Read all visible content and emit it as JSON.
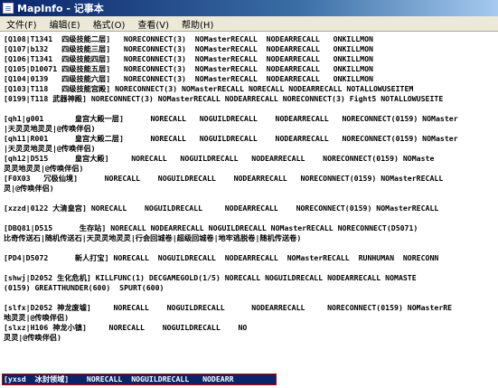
{
  "window": {
    "title": "MapInfo - 记事本"
  },
  "menu": [
    "文件(F)",
    "编辑(E)",
    "格式(O)",
    "查看(V)",
    "帮助(H)"
  ],
  "lines": [
    "[Q108|T1341  四级技能二层]   NORECONNECT(3)  NOMasterRECALL  NODEARRECALL   ONKILLMON",
    "[Q107|b132   四级技能三层]   NORECONNECT(3)  NOMasterRECALL  NODEARRECALL   ONKILLMON",
    "[Q106|T1341  四级技能四层]   NORECONNECT(3)  NOMasterRECALL  NODEARRECALL   ONKILLMON",
    "[Q105|D10071 四级技能五层]   NORECONNECT(3)  NOMasterRECALL  NODEARRECALL   ONKILLMON",
    "[Q104|0139   四级技能六层]   NORECONNECT(3)  NOMasterRECALL  NODEARRECALL   ONKILLMON",
    "[Q103|T118   四级技能宫殿] NORECONNECT(3) NOMasterRECALL NORECALL NODEARRECALL NOTALLOWUSEITEM",
    "[0199|T118 武器神殿] NORECONNECT(3) NOMasterRECALL NODEARRECALL NORECONNECT(3) Fight5 NOTALLOWUSEITE",
    "",
    "[qh1|g001       皇宫大殿一层]      NORECALL   NOGUILDRECALL    NODEARRECALL   NORECONNECT(0159) NOMaster",
    "|天灵灵地灵灵|@传唤伴侣)",
    "[qh11|R001      皇宫大殿二层]      NORECALL   NOGUILDRECALL    NODEARRECALL   NORECONNECT(0159) NOMaster",
    "|天灵灵地灵灵|@传唤伴侣)",
    "[qh12|D515      皇宫大殿]     NORECALL   NOGUILDRECALL   NODEARRECALL    NORECONNECT(0159) NOMaste",
    "灵灵地灵灵|@传唤伴侣)",
    "[F0X03   冗极仙境]      NORECALL    NOGUILDRECALL    NODEARRECALL   NORECONNECT(0159) NOMasterRECALL",
    "灵|@传唤伴侣)",
    "",
    "[xzzd|0122 大清皇宫] NORECALL    NOGUILDRECALL     NODEARRECALL    NORECONNECT(0159) NOMasterRECALL",
    "",
    "[DBQ81|D515      生存站] NORECALL NODEARRECALL NOGUILDRECALL NOMasterRECALL NORECONNECT(D5071)",
    "比奇传送石|随机传送石|天灵灵地灵灵|行会回城卷|超级回城卷|地牢逃脱卷|随机传送卷)",
    "",
    "[PD4|D5072      新人打宝] NORECALL  NOGUILDRECALL  NODEARRECALL  NOMasterRECALL  RUNHUMAN  NORECONN",
    "",
    "[shwj|D2052 生化危机] KILLFUNC(1) DECGAMEGOLD(1/5) NORECALL NOGUILDRECALL NODEARRECALL NOMASTE",
    "(0159) GREATTHUNDER(600)  SPURT(600)",
    "",
    "[slfx|D2052 神龙废墟]     NORECALL    NOGUILDRECALL      NODEARRECALL     NORECONNECT(0159) NOMasterRE",
    "地灵灵|@传唤伴侣)",
    "[slxz|H106 神龙小镇]     NORECALL    NOGUILDRECALL    NO",
    "灵灵|@传唤伴侣)"
  ],
  "selected_line": "[yxsd  冰封领域]    NORECALL  NOGUILDRECALL   NODEARR"
}
